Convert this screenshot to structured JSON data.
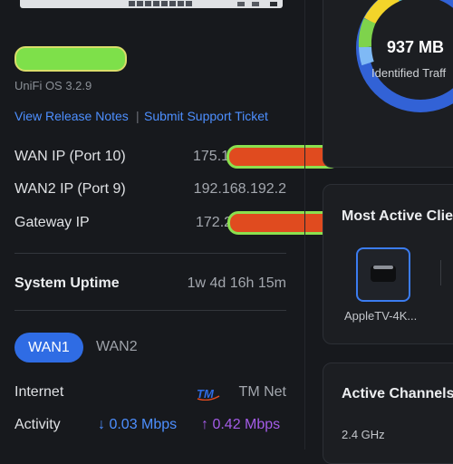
{
  "system": {
    "os_version": "UniFi OS 3.2.9",
    "release_notes_link": "View Release Notes",
    "support_link": "Submit Support Ticket",
    "link_separator": "|"
  },
  "network": {
    "wan_ip_label": "WAN IP (Port 10)",
    "wan_ip_value": "175.1",
    "wan2_ip_label": "WAN2 IP (Port 9)",
    "wan2_ip_value": "192.168.192.2",
    "gateway_ip_label": "Gateway IP",
    "gateway_ip_value": "172.2"
  },
  "uptime": {
    "label": "System Uptime",
    "value": "1w 4d 16h 15m"
  },
  "wan_tabs": {
    "active": "WAN1",
    "inactive": "WAN2"
  },
  "internet": {
    "label": "Internet",
    "isp_logo": "TM",
    "isp_name": "TM Net",
    "activity_label": "Activity",
    "download": "0.03 Mbps",
    "upload": "0.42 Mbps",
    "download_arrow": "↓",
    "upload_arrow": "↑"
  },
  "traffic": {
    "total": "937 MB",
    "label": "Identified Traff"
  },
  "most_active_clients": {
    "title": "Most Active Clie",
    "items": [
      {
        "name": "AppleTV-4K..."
      }
    ]
  },
  "active_channels": {
    "title": "Active Channels",
    "band": "2.4 GHz"
  },
  "colors": {
    "accent": "#2f6ce4",
    "download": "#4d8fff",
    "upload": "#a45ce8",
    "background": "#17191d"
  }
}
